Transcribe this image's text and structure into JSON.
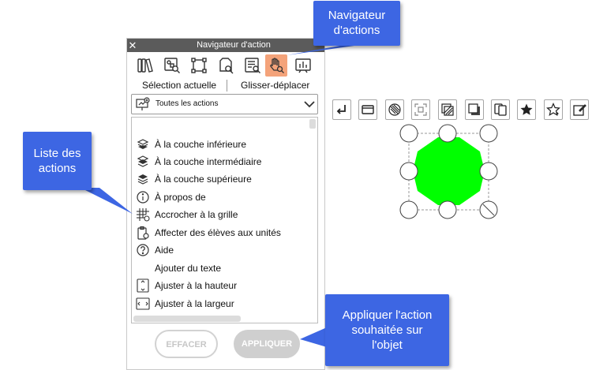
{
  "panel": {
    "title": "Navigateur d'action",
    "close_glyph": "✕",
    "tabs": [
      {
        "icon": "books-icon"
      },
      {
        "icon": "objects-search-icon"
      },
      {
        "icon": "selection-square-icon"
      },
      {
        "icon": "page-search-icon"
      },
      {
        "icon": "list-search-icon"
      },
      {
        "icon": "hand-search-icon",
        "active": true
      },
      {
        "icon": "chart-icon"
      }
    ],
    "subtabs": {
      "current": "Sélection actuelle",
      "drag": "Glisser-déplacer"
    },
    "filter": {
      "value": "Toutes les actions"
    },
    "actions": [
      {
        "label": "À la couche inférieure",
        "icon": "layer-bottom-icon"
      },
      {
        "label": "À la couche intermédiaire",
        "icon": "layer-middle-icon"
      },
      {
        "label": "À la couche supérieure",
        "icon": "layer-top-icon"
      },
      {
        "label": "À propos de",
        "icon": "info-icon"
      },
      {
        "label": "Accrocher à la grille",
        "icon": "grid-snap-icon"
      },
      {
        "label": "Affecter des élèves aux unités",
        "icon": "assign-students-icon"
      },
      {
        "label": "Aide",
        "icon": "help-icon"
      },
      {
        "label": "Ajouter du texte",
        "icon": ""
      },
      {
        "label": "Ajuster à la hauteur",
        "icon": "fit-height-icon"
      },
      {
        "label": "Ajuster à la largeur",
        "icon": "fit-width-icon"
      }
    ],
    "buttons": {
      "clear": "EFFACER",
      "apply": "APPLIQUER"
    }
  },
  "toolbar": [
    {
      "icon": "arrow-return-icon"
    },
    {
      "icon": "window-icon"
    },
    {
      "icon": "texture-fill-icon"
    },
    {
      "icon": "frame-select-icon"
    },
    {
      "icon": "hatch-square-icon"
    },
    {
      "icon": "shadow-square-icon"
    },
    {
      "icon": "copy-pages-icon"
    },
    {
      "icon": "star-filled-icon"
    },
    {
      "icon": "star-outline-icon"
    },
    {
      "icon": "edit-square-icon"
    }
  ],
  "shape": {
    "type": "octagon",
    "fill": "#00ff00"
  },
  "callouts": {
    "navigator": [
      "Navigateur",
      "d'actions"
    ],
    "list": [
      "Liste des",
      "actions"
    ],
    "apply": [
      "Appliquer  l'action",
      "souhaitée sur",
      "l'objet"
    ]
  },
  "colors": {
    "callout": "#3d66e3",
    "active_tab": "#f4a37a",
    "shape_green": "#00ff00",
    "titlebar": "#5b5b5b"
  }
}
